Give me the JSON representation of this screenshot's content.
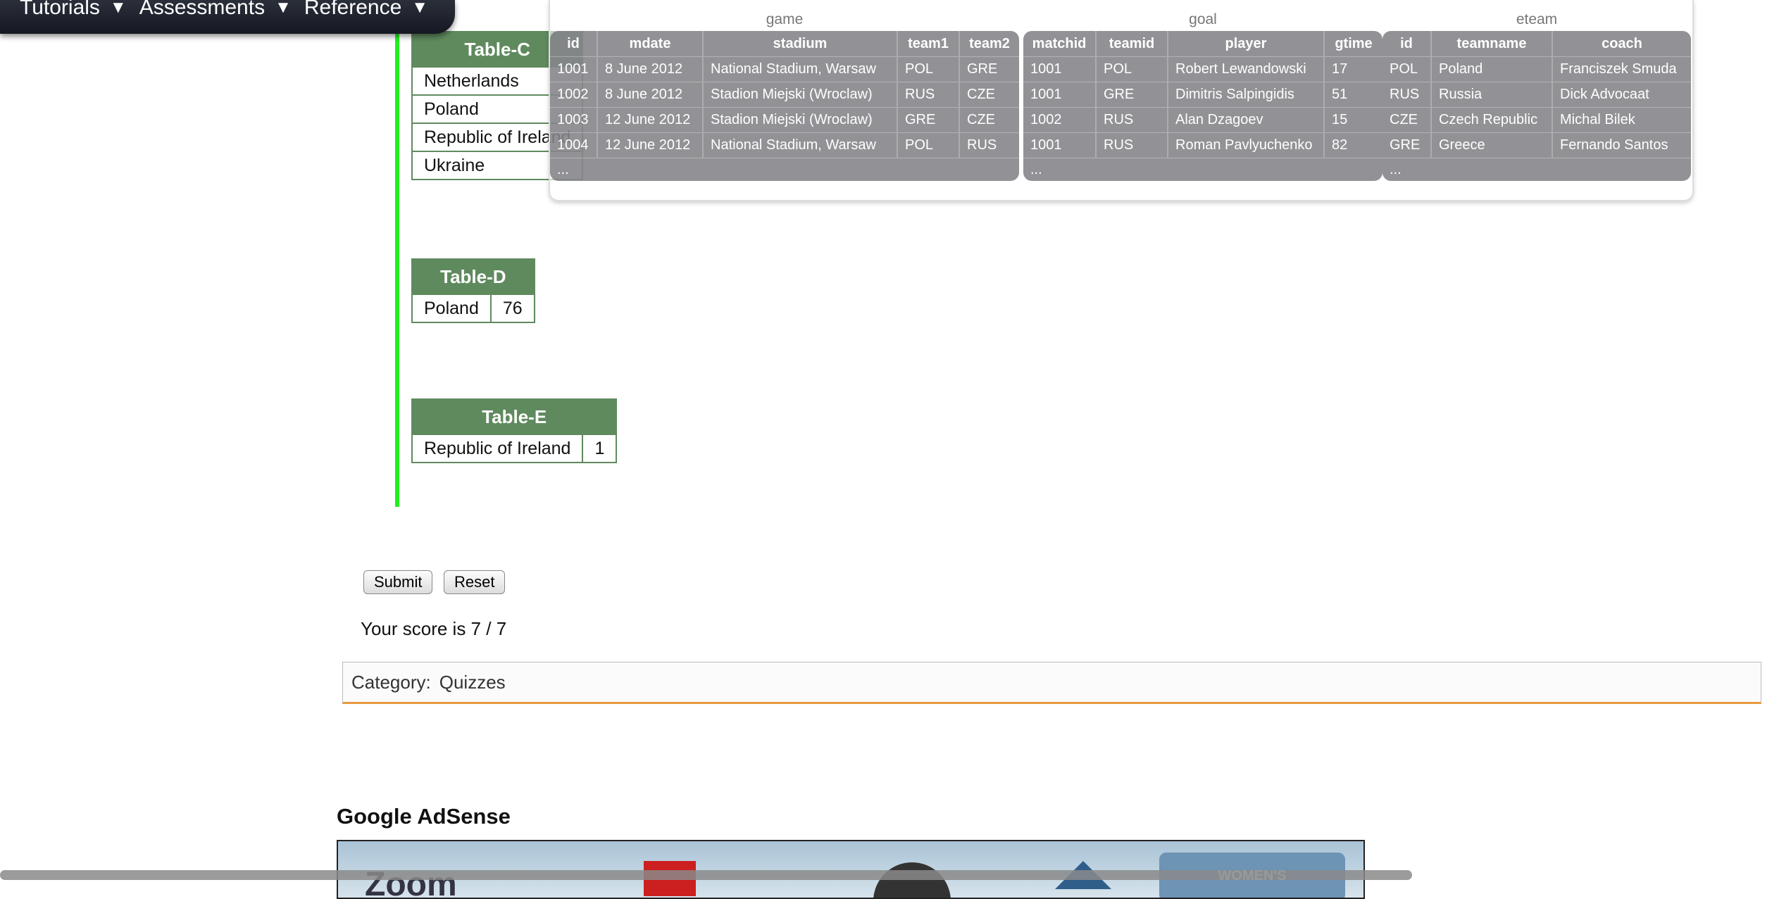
{
  "nav": {
    "items": [
      {
        "label": "Tutorials"
      },
      {
        "label": "Assessments"
      },
      {
        "label": "Reference"
      }
    ]
  },
  "answer_tables": {
    "table_c": {
      "title": "Table-C",
      "rows": [
        "Netherlands",
        "Poland",
        "Republic of Ireland",
        "Ukraine"
      ]
    },
    "table_d": {
      "title": "Table-D",
      "rows": [
        [
          "Poland",
          "76"
        ]
      ]
    },
    "table_e": {
      "title": "Table-E",
      "rows": [
        [
          "Republic of Ireland",
          "1"
        ]
      ]
    }
  },
  "schema": {
    "game": {
      "caption": "game",
      "headers": [
        "id",
        "mdate",
        "stadium",
        "team1",
        "team2"
      ],
      "rows": [
        [
          "1001",
          "8 June 2012",
          "National Stadium, Warsaw",
          "POL",
          "GRE"
        ],
        [
          "1002",
          "8 June 2012",
          "Stadion Miejski (Wroclaw)",
          "RUS",
          "CZE"
        ],
        [
          "1003",
          "12 June 2012",
          "Stadion Miejski (Wroclaw)",
          "GRE",
          "CZE"
        ],
        [
          "1004",
          "12 June 2012",
          "National Stadium, Warsaw",
          "POL",
          "RUS"
        ]
      ],
      "ellipsis": "..."
    },
    "goal": {
      "caption": "goal",
      "headers": [
        "matchid",
        "teamid",
        "player",
        "gtime"
      ],
      "rows": [
        [
          "1001",
          "POL",
          "Robert Lewandowski",
          "17"
        ],
        [
          "1001",
          "GRE",
          "Dimitris Salpingidis",
          "51"
        ],
        [
          "1002",
          "RUS",
          "Alan Dzagoev",
          "15"
        ],
        [
          "1001",
          "RUS",
          "Roman Pavlyuchenko",
          "82"
        ]
      ],
      "ellipsis": "..."
    },
    "eteam": {
      "caption": "eteam",
      "headers": [
        "id",
        "teamname",
        "coach"
      ],
      "rows": [
        [
          "POL",
          "Poland",
          "Franciszek Smuda"
        ],
        [
          "RUS",
          "Russia",
          "Dick Advocaat"
        ],
        [
          "CZE",
          "Czech Republic",
          "Michal Bilek"
        ],
        [
          "GRE",
          "Greece",
          "Fernando Santos"
        ]
      ],
      "ellipsis": "..."
    }
  },
  "form": {
    "submit_label": "Submit",
    "reset_label": "Reset",
    "score_text": "Your score is 7 / 7"
  },
  "category": {
    "label": "Category:",
    "value": "Quizzes"
  },
  "adsense": {
    "title": "Google AdSense",
    "badge_text": "WOMEN'S",
    "logo_text": "Zoom"
  },
  "colors": {
    "table_header": "#5f8a5e",
    "progress_bar": "#22ee22",
    "category_underline": "#e89a40"
  }
}
